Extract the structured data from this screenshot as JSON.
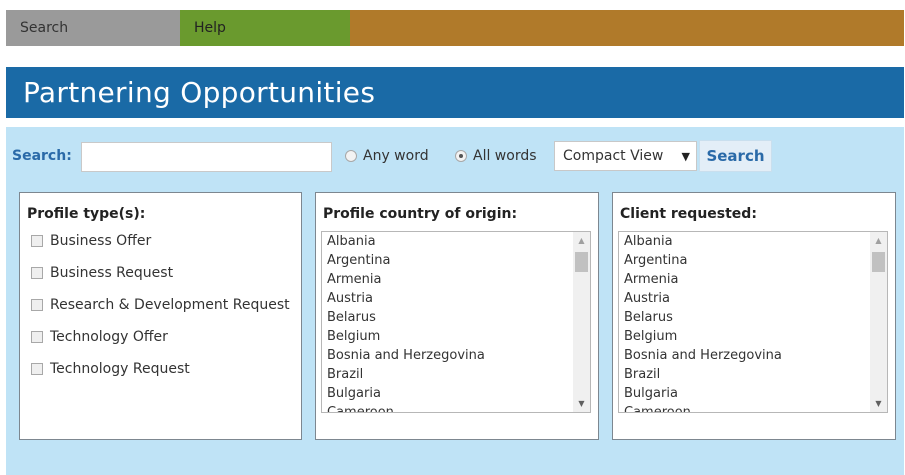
{
  "nav": {
    "search": "Search",
    "help": "Help"
  },
  "page_title": "Partnering Opportunities",
  "search": {
    "label": "Search:",
    "value": "",
    "any_word": "Any word",
    "all_words": "All words",
    "selected_match": "All words",
    "view_select": "Compact View",
    "button": "Search"
  },
  "profile_types": {
    "title": "Profile type(s):",
    "items": [
      {
        "label": "Business Offer",
        "checked": false
      },
      {
        "label": "Business Request",
        "checked": false
      },
      {
        "label": "Research & Development Request",
        "checked": false
      },
      {
        "label": "Technology Offer",
        "checked": false
      },
      {
        "label": "Technology Request",
        "checked": false
      }
    ]
  },
  "country": {
    "title": "Profile country of origin:",
    "items": [
      "Albania",
      "Argentina",
      "Armenia",
      "Austria",
      "Belarus",
      "Belgium",
      "Bosnia and Herzegovina",
      "Brazil",
      "Bulgaria",
      "Cameroon"
    ]
  },
  "client": {
    "title": "Client requested:",
    "items": [
      "Albania",
      "Argentina",
      "Armenia",
      "Austria",
      "Belarus",
      "Belgium",
      "Bosnia and Herzegovina",
      "Brazil",
      "Bulgaria",
      "Cameroon"
    ]
  },
  "colors": {
    "title_bar": "#1a6aa6",
    "panel": "#bfe3f6",
    "nav_search": "#9a9a9a",
    "nav_help": "#6a9a2e",
    "nav_fill": "#b07a2a"
  }
}
